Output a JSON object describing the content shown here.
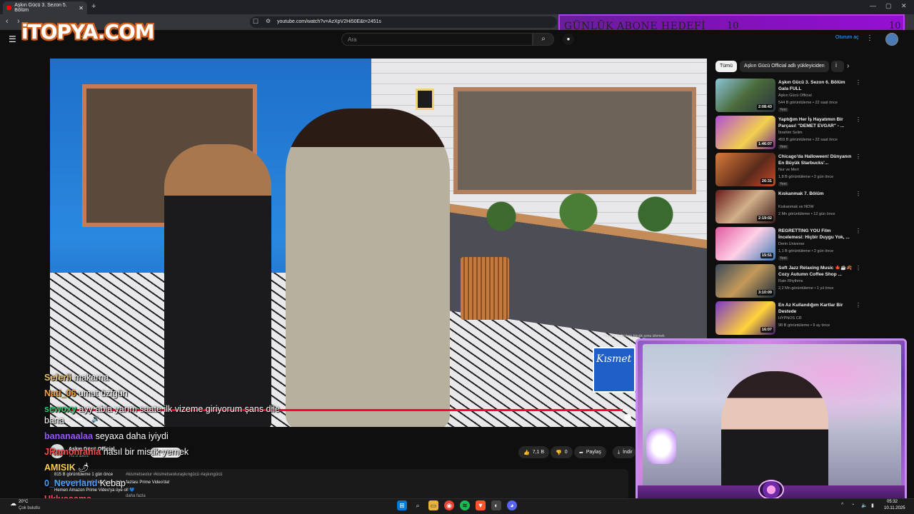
{
  "browser": {
    "tab_title": "Aşkın Gücü 3. Sezon 5. Bölüm",
    "new_tab": "+",
    "url": "youtube.com/watch?v=AzXpV2Hi50E&t=2451s",
    "min": "—",
    "max": "▢",
    "close": "✕",
    "back": "‹",
    "forward": "›",
    "reload": "⟳"
  },
  "logo": "iTOPYA.COM",
  "sub_goal": {
    "title": "GÜNLÜK ABONE HEDEFİ",
    "current": "10",
    "max": "10"
  },
  "yt_header": {
    "search_placeholder": "Ara",
    "search_icon": "search-icon",
    "login": "Oturum aç"
  },
  "player": {
    "progress_fraction": 0.99,
    "time": "2:04:28 / 2:05:01",
    "overlay_text": "Hayatın değiştiren büyük sonu izlemek",
    "sponsor_text": "Kısmet"
  },
  "video_info": {
    "channel": "Aşkın Gücü Official",
    "subs": "742 B abone",
    "subscribe": "Abone ol",
    "likes": "7,1 B",
    "dislikes": "0",
    "share": "Paylaş",
    "download": "İndir",
    "views_date": "815 B görüntüleme  1 gün önce",
    "tags": "#kismetseolur #kismetseoluraşkıngücü #aşkıngücü",
    "line1": "Kısmetse olur ile ilgili videoların daha fazlası Prime Video'da!",
    "line2": "Hemen Amazon Prime Video'ya üye ol! 💙",
    "more": "daha fazla"
  },
  "sidebar": {
    "chips": [
      "Tümü",
      "Aşkın Gücü Official adlı yükleyiciden",
      "İ"
    ],
    "items": [
      {
        "title": "Aşkın Gücü 3. Sezon 6. Bölüm Gala FULL",
        "channel": "Aşkın Gücü Official",
        "meta": "544 B görüntüleme • 22 saat önce",
        "badge": "Yeni",
        "duration": "2:08:43"
      },
      {
        "title": "Yaptığım Her İş Hayatımın Bir Parçası! \"DEMET EVGAR\" - ...",
        "channel": "İbrahim Selim",
        "meta": "459 B görüntüleme • 22 saat önce",
        "badge": "Yeni",
        "duration": "1:46:07"
      },
      {
        "title": "Chicago'da Halloween! Dünyanın En Büyük Starbucks'...",
        "channel": "Nur ve Mert",
        "meta": "1,8 B görüntüleme • 2 gün önce",
        "badge": "Yeni",
        "duration": "26:31"
      },
      {
        "title": "Kıskanmak 7. Bölüm",
        "channel": "Kıskanmak ve NOW",
        "meta": "2 Mn görüntüleme • 12 gün önce",
        "badge": "",
        "duration": "2:19:02"
      },
      {
        "title": "REGRETTING YOU Film İncelemesi: Hiçbir Duygu Yok, ...",
        "channel": "Derin Universe",
        "meta": "1,1 B görüntüleme • 2 gün önce",
        "badge": "Yeni",
        "duration": "15:51"
      },
      {
        "title": "Soft Jazz Relaxing Music 🍁☕🍂 Cozy Autumn Coffee Shop ...",
        "channel": "Rain Rhythms",
        "meta": "2,2 Mn görüntüleme • 1 yıl önce",
        "badge": "",
        "duration": "3:10:09"
      },
      {
        "title": "En Az Kullandığım Kartlar Bir Destede",
        "channel": "HYPNOS CR",
        "meta": "98 B görüntüleme • 9 ay önce",
        "badge": "",
        "duration": "16:07"
      }
    ]
  },
  "chat": [
    {
      "nick": "Seferii",
      "msg": "makarna",
      "color": "#e8c070"
    },
    {
      "nick": "Nati_06",
      "msg": "umut üzfgün",
      "color": "#f0a040"
    },
    {
      "nick": "sewoxy",
      "msg": "ayy abla yarım saate ilk vizeme giriyorum şans dile",
      "color": "#2ecc71"
    },
    {
      "nick": "",
      "msg": "bana",
      "color": "#ffffff"
    },
    {
      "nick": "bananaalaa",
      "msg": "seyaxa daha iyiydi",
      "color": "#9b59ff"
    },
    {
      "nick": "JRamonrahia",
      "msg": "nasıl bir mistik yemek",
      "color": "#ff4d4d"
    },
    {
      "nick": "AMISIK",
      "msg": "🌶",
      "color": "#ffd24d"
    },
    {
      "nick": "0_Neverland",
      "msg": "Kebap",
      "color": "#4d9dff"
    },
    {
      "nick": "Uklyosama",
      "msg": "",
      "color": "#ff4d6d"
    }
  ],
  "taskbar": {
    "weather_temp": "20°C",
    "weather_desc": "Çok bulutlu",
    "time": "05:32",
    "date": "10.11.2025"
  },
  "colors": {
    "yt_red": "#ff0033",
    "goal_purple": "#7d12b3",
    "link_blue": "#3ea6ff"
  }
}
